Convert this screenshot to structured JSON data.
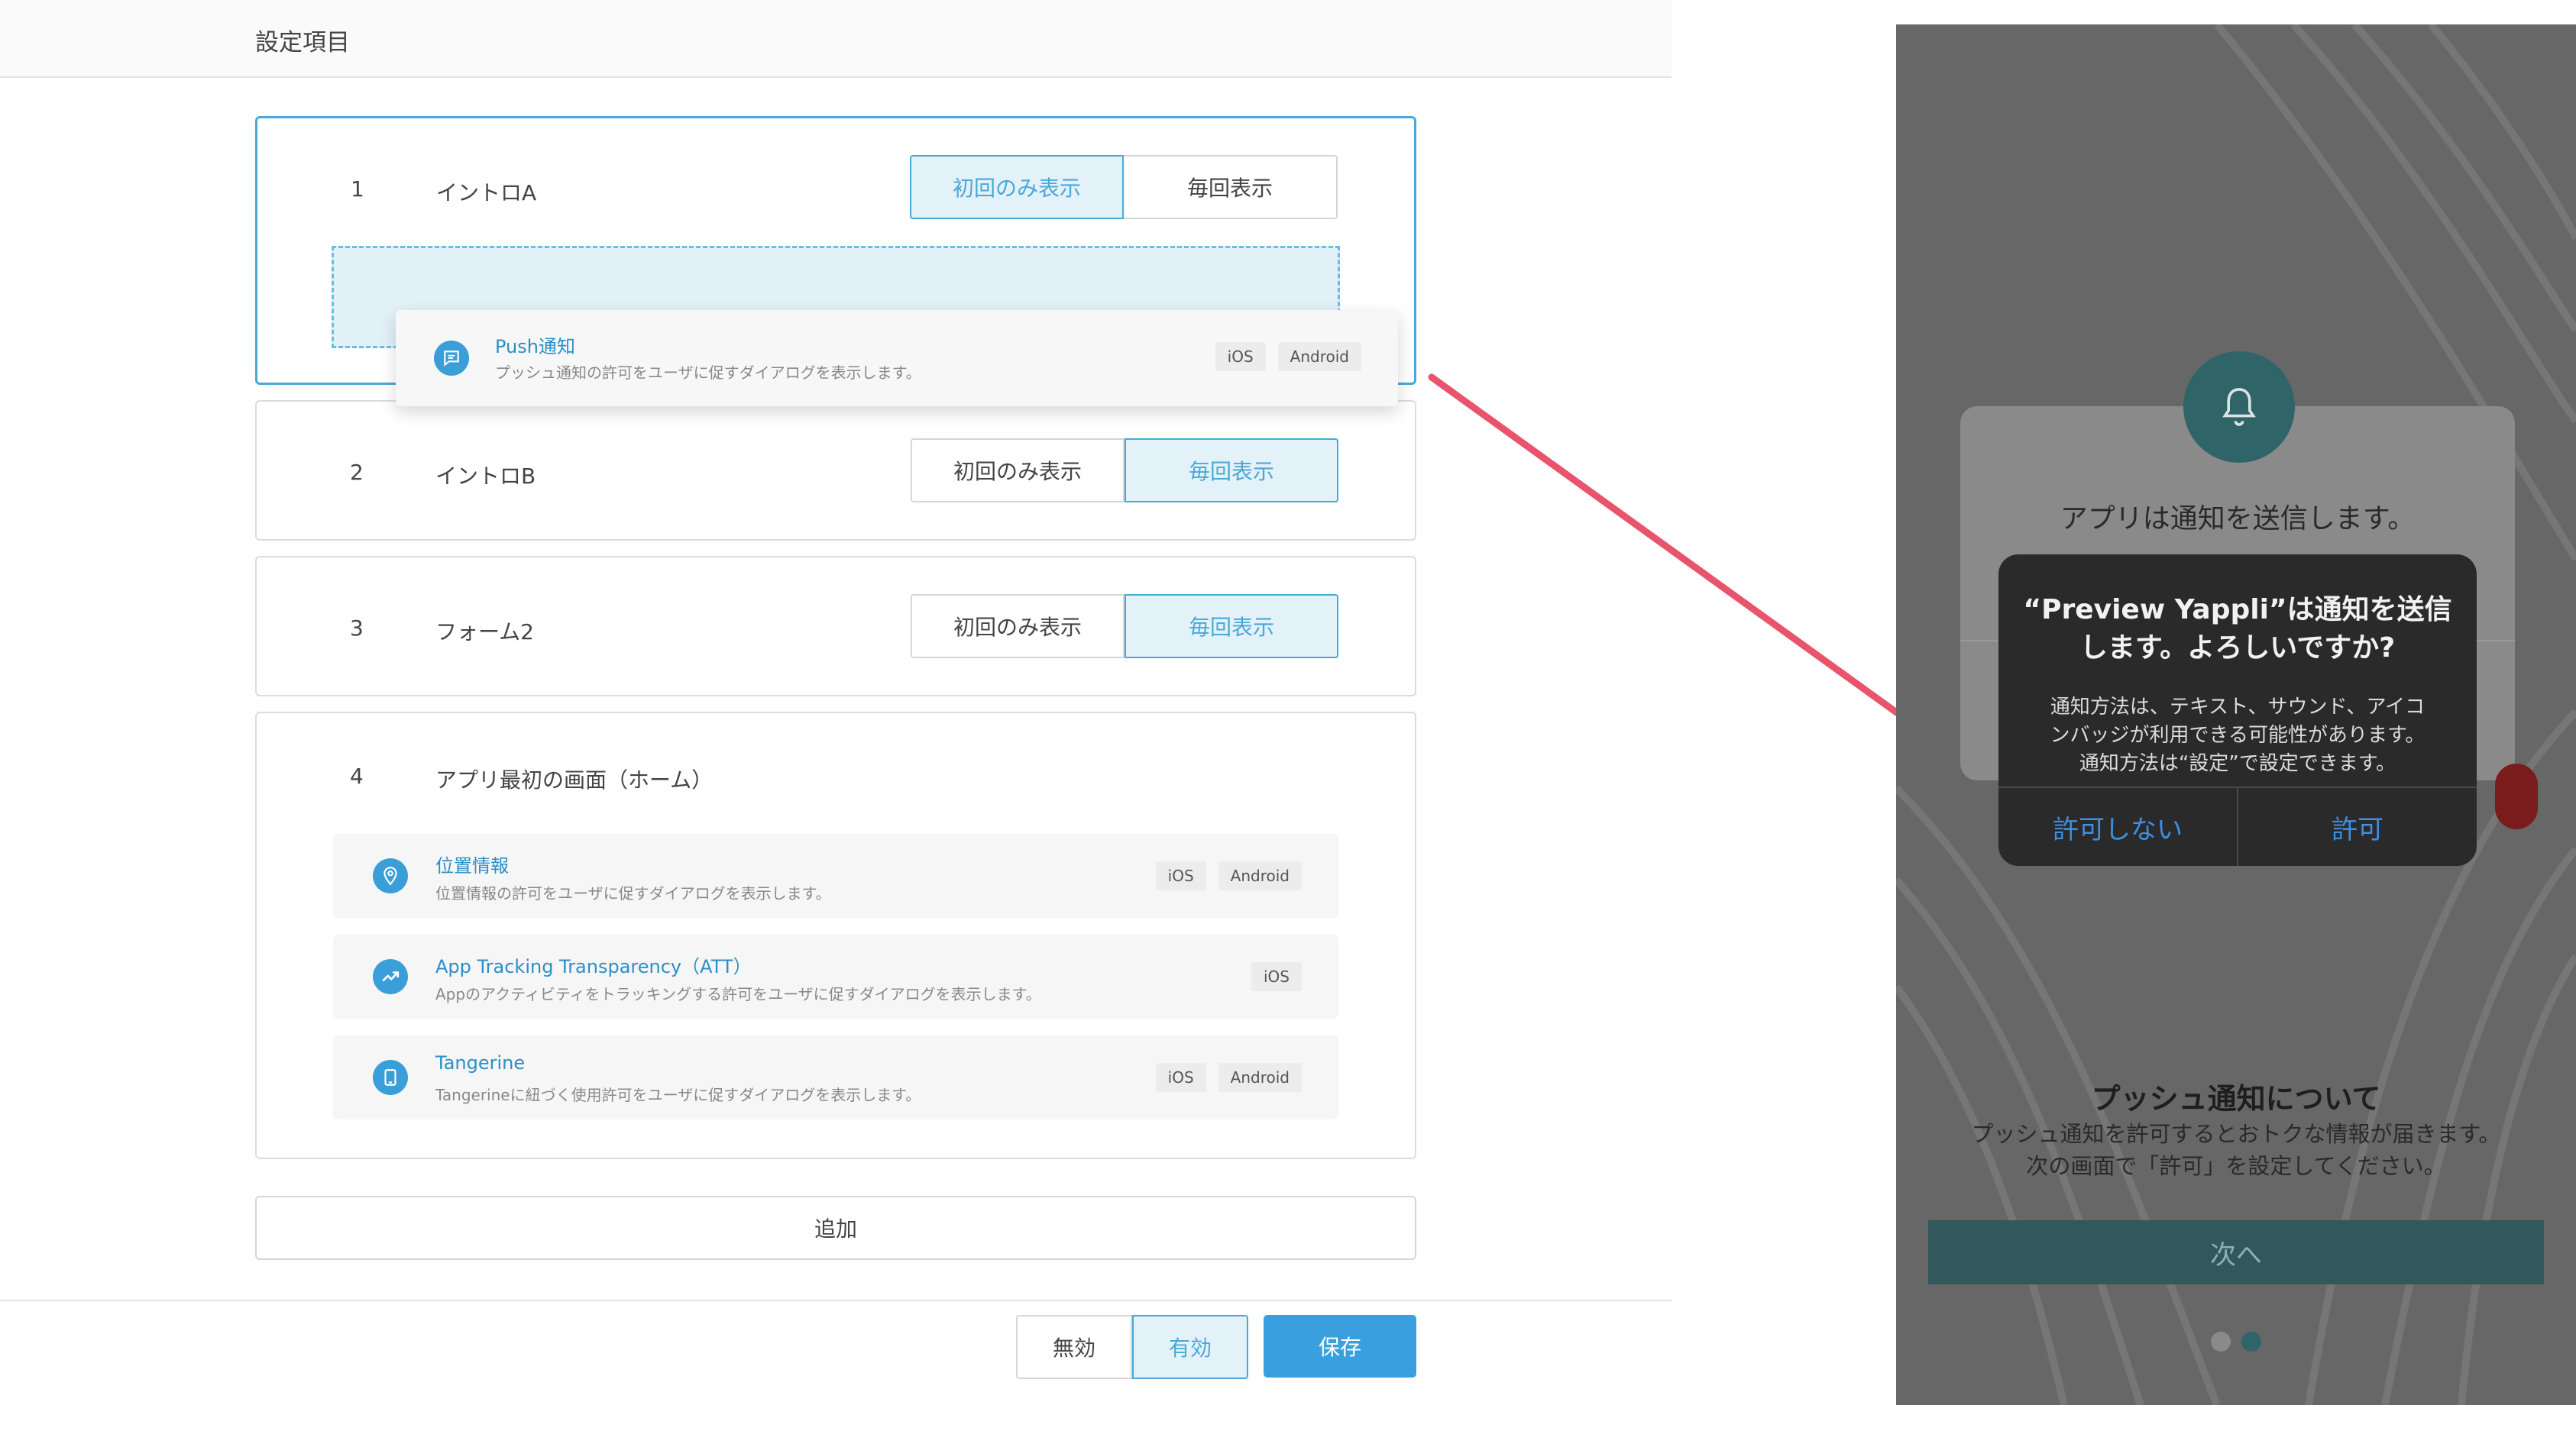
{
  "header": {
    "title": "設定項目"
  },
  "items": [
    {
      "number": "1",
      "name": "イントロA",
      "option_once": "初回のみ表示",
      "option_every": "毎回表示",
      "selected": "once"
    },
    {
      "number": "2",
      "name": "イントロB",
      "option_once": "初回のみ表示",
      "option_every": "毎回表示",
      "selected": "every"
    },
    {
      "number": "3",
      "name": "フォーム2",
      "option_once": "初回のみ表示",
      "option_every": "毎回表示",
      "selected": "every"
    },
    {
      "number": "4",
      "name": "アプリ最初の画面（ホーム）"
    }
  ],
  "dragging_item": {
    "title": "Push通知",
    "desc": "プッシュ通知の許可をユーザに促すダイアログを表示します。",
    "tags": [
      "iOS",
      "Android"
    ],
    "icon": "chat-bubble-icon"
  },
  "permissions": [
    {
      "title": "位置情報",
      "desc": "位置情報の許可をユーザに促すダイアログを表示します。",
      "tags": [
        "iOS",
        "Android"
      ],
      "icon": "location-pin-icon"
    },
    {
      "title": "App Tracking Transparency（ATT）",
      "desc": "Appのアクティビティをトラッキングする許可をユーザに促すダイアログを表示します。",
      "tags": [
        "iOS"
      ],
      "icon": "trend-line-icon"
    },
    {
      "title": "Tangerine",
      "desc": "Tangerineに紐づく使用許可をユーザに促すダイアログを表示します。",
      "tags": [
        "iOS",
        "Android"
      ],
      "icon": "tablet-icon"
    }
  ],
  "add_button": "追加",
  "footer": {
    "disable": "無効",
    "enable": "有効",
    "enabled": true,
    "save": "保存"
  },
  "colors": {
    "accent": "#3a9fdf",
    "selected_bg": "#e3f1f9",
    "arrow": "#e8546b"
  },
  "phone": {
    "back_dialog_text": "アプリは通知を送信します。",
    "ios_alert": {
      "title_line1": "“Preview Yappli”は通知を送信",
      "title_line2": "します。よろしいですか?",
      "msg_line1": "通知方法は、テキスト、サウンド、アイコ",
      "msg_line2": "ンバッジが利用できる可能性があります。",
      "msg_line3": "通知方法は“設定”で設定できます。",
      "deny": "許可しない",
      "allow": "許可"
    },
    "push_heading": "プッシュ通知について",
    "push_body_line1": "プッシュ通知を許可するとおトクな情報が届きます。",
    "push_body_line2": "次の画面で「許可」を設定してください。",
    "next_button": "次へ",
    "pager": {
      "count": 2,
      "active": 2
    }
  }
}
